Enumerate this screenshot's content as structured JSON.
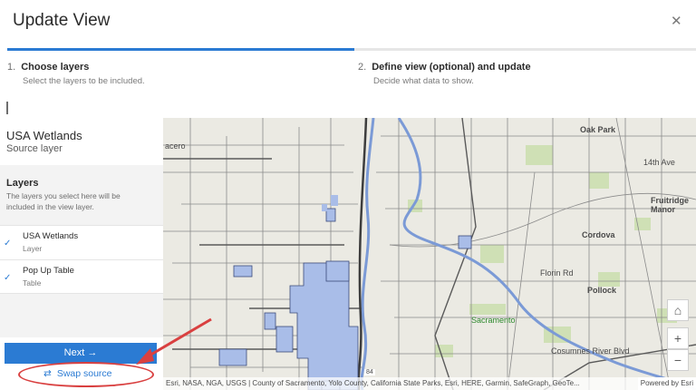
{
  "dialog": {
    "title": "Update View",
    "close_label": "✕"
  },
  "steps": [
    {
      "num": "1.",
      "title": "Choose layers",
      "sub": "Select the layers to be included."
    },
    {
      "num": "2.",
      "title": "Define view (optional) and update",
      "sub": "Decide what data to show."
    }
  ],
  "source": {
    "name": "USA Wetlands",
    "label": "Source layer"
  },
  "layers": {
    "title": "Layers",
    "description": "The layers you select here will be included in the view layer.",
    "items": [
      {
        "name": "USA Wetlands",
        "type": "Layer"
      },
      {
        "name": "Pop Up Table",
        "type": "Table"
      }
    ]
  },
  "actions": {
    "next_label": "Next",
    "next_arrow": "→",
    "swap_label": "Swap source",
    "swap_icon": "⇄"
  },
  "map": {
    "labels": [
      "acero",
      "Oak Park",
      "14th Ave",
      "Fruitridge Manor",
      "Cordova",
      "Florin Rd",
      "Pollock",
      "Sacramento",
      "Cosumnes River Blvd",
      "84"
    ],
    "attribution": "Esri, NASA, NGA, USGS | County of Sacramento, Yolo County, California State Parks, Esri, HERE, Garmin, SafeGraph, GeoTe...",
    "powered_by": "Powered by Esri",
    "home_icon": "⌂",
    "zoom_in": "+",
    "zoom_out": "−"
  },
  "colors": {
    "accent": "#2b7bd3",
    "wetland": "#a9bde8",
    "annotation": "#d94040"
  }
}
